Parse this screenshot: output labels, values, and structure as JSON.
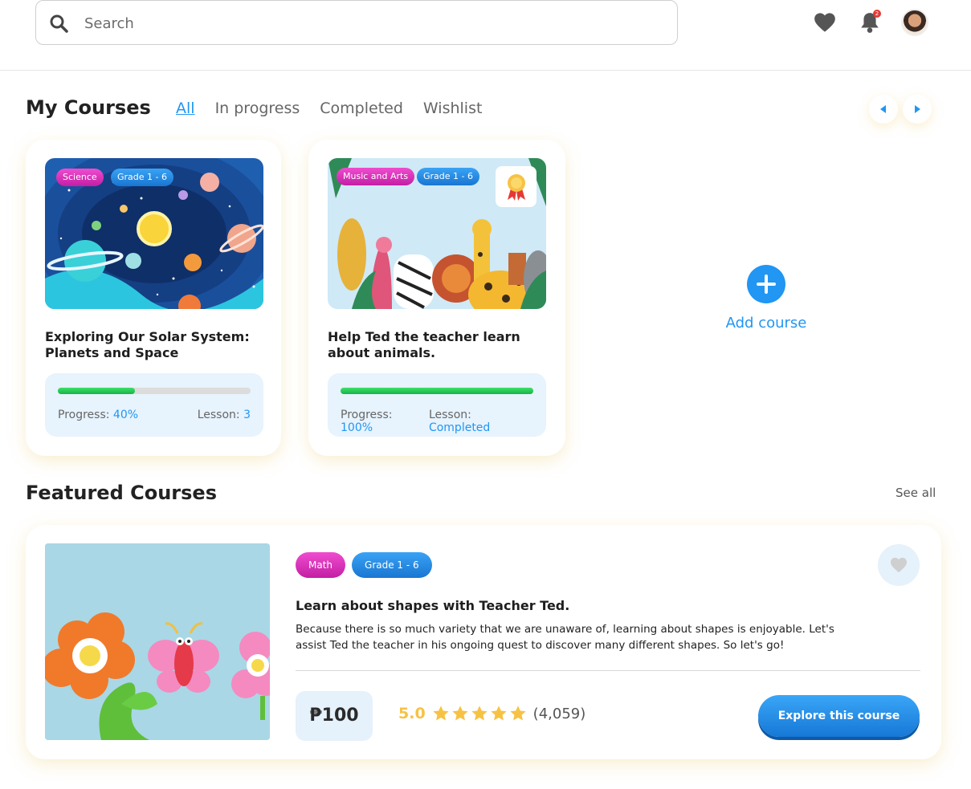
{
  "header": {
    "search_placeholder": "Search",
    "notification_count": "2",
    "icons": [
      "search-icon",
      "heart-icon",
      "bell-icon",
      "avatar"
    ]
  },
  "my_courses": {
    "title": "My Courses",
    "tabs": [
      "All",
      "In progress",
      "Completed",
      "Wishlist"
    ],
    "active_tab": "All",
    "courses": [
      {
        "tags": [
          "Science",
          "Grade 1 - 6"
        ],
        "title": "Exploring Our Solar System: Planets and Space",
        "progress_label": "Progress:",
        "progress_value": "40%",
        "progress_fraction": 0.4,
        "lesson_label": "Lesson:",
        "lesson_value": "3"
      },
      {
        "tags": [
          "Music and Arts",
          "Grade 1 - 6"
        ],
        "title": "Help Ted the teacher learn about animals.",
        "progress_label": "Progress:",
        "progress_value": "100%",
        "progress_fraction": 1.0,
        "lesson_label": "Lesson:",
        "lesson_value": "Completed",
        "badge": "award-ribbon-icon"
      }
    ],
    "add_course_label": "Add course"
  },
  "featured": {
    "title": "Featured Courses",
    "see_all": "See all",
    "course": {
      "tags": [
        "Math",
        "Grade 1 - 6"
      ],
      "title": "Learn about shapes with Teacher Ted.",
      "description": "Because there is so much variety that we are unaware of, learning about shapes is enjoyable. Let's assist Ted the teacher in his ongoing quest to discover many different shapes. So let's go!",
      "price": "₱100",
      "rating": "5.0",
      "stars": 5,
      "reviews": "(4,059)",
      "cta": "Explore this course"
    }
  },
  "colors": {
    "accent": "#2196f3",
    "progress_green": "#22c55e",
    "tag_pink": "#d92bb5",
    "tag_blue": "#2a8ee8",
    "star": "#f7c244"
  }
}
